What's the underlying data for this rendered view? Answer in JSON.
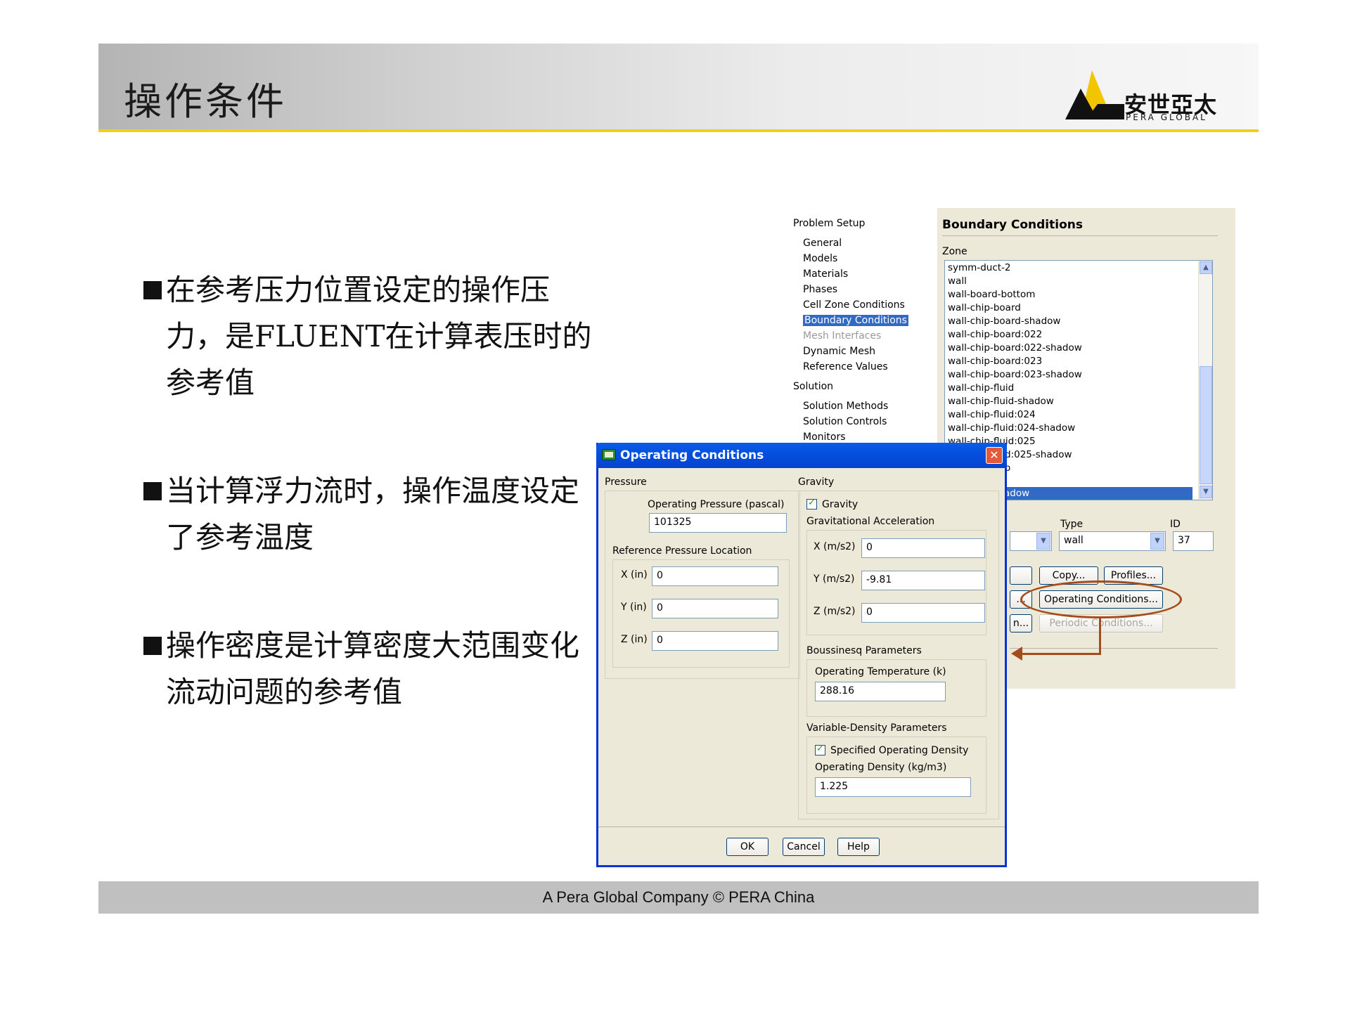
{
  "slide": {
    "title": "操作条件",
    "logo_cn": "安世亞太",
    "logo_en": "PERA GLOBAL",
    "footer": "A Pera Global Company ©  PERA China"
  },
  "bullets": [
    "在参考压力位置设定的操作压力，是FLUENT在计算表压时的参考值",
    "当计算浮力流时，操作温度设定了参考温度",
    "操作密度是计算密度大范围变化流动问题的参考值"
  ],
  "tree": {
    "problem_setup": "Problem Setup",
    "general": "General",
    "models": "Models",
    "materials": "Materials",
    "phases": "Phases",
    "cell_zone_conditions": "Cell Zone Conditions",
    "boundary_conditions": "Boundary Conditions",
    "mesh_interfaces": "Mesh Interfaces",
    "dynamic_mesh": "Dynamic Mesh",
    "reference_values": "Reference Values",
    "solution": "Solution",
    "solution_methods": "Solution Methods",
    "solution_controls": "Solution Controls",
    "monitors": "Monitors"
  },
  "boundary": {
    "title": "Boundary Conditions",
    "zone_label": "Zone",
    "zones": [
      "symm-duct-2",
      "wall",
      "wall-board-bottom",
      "wall-chip-board",
      "wall-chip-board-shadow",
      "wall-chip-board:022",
      "wall-chip-board:022-shadow",
      "wall-chip-board:023",
      "wall-chip-board:023-shadow",
      "wall-chip-fluid",
      "wall-chip-fluid-shadow",
      "wall-chip-fluid:024",
      "wall-chip-fluid:024-shadow",
      "wall-chip-fluid:025",
      "d:025-shadow",
      "o"
    ],
    "selected_zone": "adow",
    "type_label": "Type",
    "type_value": "wall",
    "id_label": "ID",
    "id_value": "37",
    "copy_label": "Copy...",
    "profiles_label": "Profiles...",
    "operating_conditions_label": "Operating Conditions...",
    "periodic_conditions_label": "Periodic Conditions...",
    "partial_1": "...",
    "partial_2": "n..."
  },
  "dialog": {
    "title": "Operating Conditions",
    "close": "✕",
    "pressure_group": "Pressure",
    "operating_pressure_label": "Operating Pressure (pascal)",
    "operating_pressure": "101325",
    "ref_location_label": "Reference Pressure Location",
    "x_in_label": "X (in)",
    "x_in": "0",
    "y_in_label": "Y (in)",
    "y_in": "0",
    "z_in_label": "Z (in)",
    "z_in": "0",
    "gravity_group": "Gravity",
    "gravity_checkbox": "Gravity",
    "grav_accel_label": "Gravitational Acceleration",
    "x_ms2_label": "X (m/s2)",
    "x_ms2": "0",
    "y_ms2_label": "Y (m/s2)",
    "y_ms2": "-9.81",
    "z_ms2_label": "Z (m/s2)",
    "z_ms2": "0",
    "boussinesq_label": "Boussinesq Parameters",
    "op_temp_label": "Operating Temperature (k)",
    "op_temp": "288.16",
    "var_density_label": "Variable-Density Parameters",
    "specified_density_label": "Specified Operating Density",
    "op_density_label": "Operating Density (kg/m3)",
    "op_density": "1.225",
    "ok": "OK",
    "cancel": "Cancel",
    "help": "Help"
  }
}
